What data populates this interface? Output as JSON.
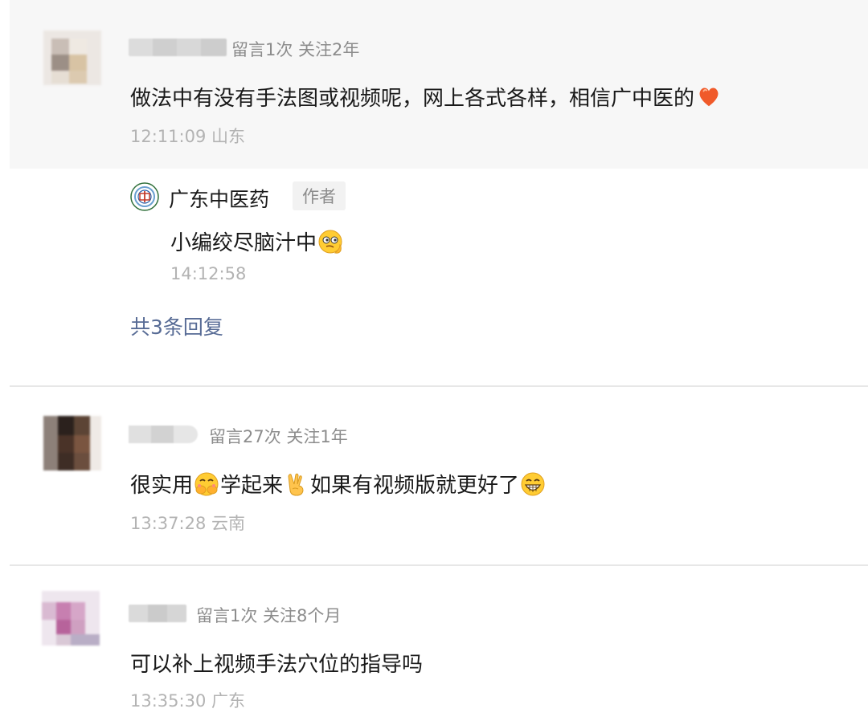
{
  "comments": [
    {
      "meta": "留言1次 关注2年",
      "text": "做法中有没有手法图或视频呢，网上各式各样，相信广中医的",
      "emoji": "heart-emoji",
      "time": "12:11:09 山东",
      "reply": {
        "name": "广东中医药",
        "tag": "作者",
        "text": "小编绞尽脑汁中",
        "emoji": "thinking-face-emoji",
        "time": "14:12:58"
      },
      "more_replies": "共3条回复"
    },
    {
      "meta": "留言27次 关注1年",
      "text_parts": [
        "很实用",
        "学起来",
        "如果有视频版就更好了"
      ],
      "emojis": [
        "giggle-emoji",
        "victory-hand-emoji",
        "grin-emoji"
      ],
      "time": "13:37:28 云南"
    },
    {
      "meta": "留言1次 关注8个月",
      "text": "可以补上视频手法穴位的指导吗",
      "time": "13:35:30 广东"
    }
  ],
  "colors": {
    "link": "#576b95",
    "meta": "#8c8c8c",
    "time": "#b3b3b3",
    "highlight_bg": "#f7f7f7",
    "divider": "#e7e7e7"
  }
}
